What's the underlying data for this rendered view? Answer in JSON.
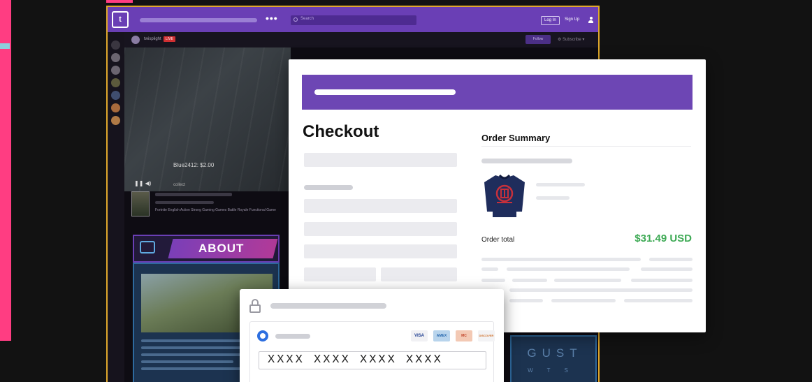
{
  "twitch": {
    "logo_glyph": "t",
    "search_placeholder": "Search",
    "menu_dots": "•••",
    "login_label": "Log In",
    "signup_label": "Sign Up",
    "channel_name": "twisplight",
    "live_badge": "LIVE",
    "follow_label": "Follow",
    "controls_text": "⚙ Subscribe ▾",
    "video_alert": "Blue2412: $2.00",
    "video_controls": "❚❚ ◀)",
    "collect_text": "collect",
    "game_tags": "Fortnite   English   Action   Strong Gaming Games   Battle Royale   Functional Game",
    "about_title": "ABOUT",
    "right_panel_title": "GUST",
    "right_panel_sub": "WTS"
  },
  "checkout": {
    "title": "Checkout",
    "order_summary_title": "Order Summary",
    "order_total_label": "Order total",
    "order_total_value": "$31.49 USD",
    "accent_color": "#6d46b4",
    "total_color": "#3eaa55"
  },
  "payment": {
    "card_brands": [
      "VISA",
      "AMEX",
      "MC",
      "DISCOVER"
    ],
    "card_number_placeholder": "XXXX  XXXX  XXXX  XXXX"
  }
}
